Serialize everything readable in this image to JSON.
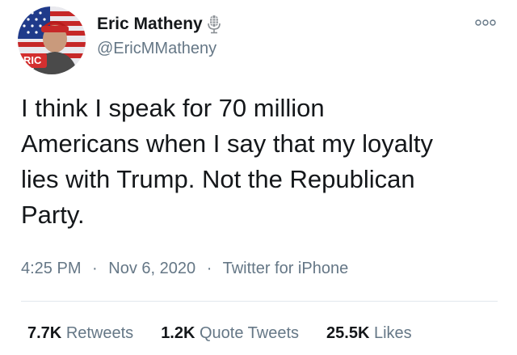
{
  "user": {
    "display_name": "Eric Matheny",
    "handle": "@EricMMatheny",
    "avatar_badge_text": "RIC",
    "badge_icon": "microphone-icon"
  },
  "tweet": {
    "text": "I think I speak for 70 million\nAmericans when I say that my loyalty\nlies with Trump. Not the Republican\nParty.",
    "time": "4:25 PM",
    "separator": "·",
    "date": "Nov 6, 2020",
    "source": "Twitter for iPhone"
  },
  "stats": {
    "retweets_count": "7.7K",
    "retweets_label": "Retweets",
    "quote_tweets_count": "1.2K",
    "quote_tweets_label": "Quote Tweets",
    "likes_count": "25.5K",
    "likes_label": "Likes"
  },
  "menu": {
    "more_icon": "more-options-icon"
  },
  "colors": {
    "primary_text": "#14171a",
    "secondary_text": "#657786",
    "divider": "#e1e8ed",
    "badge_red": "#d32f2f"
  }
}
